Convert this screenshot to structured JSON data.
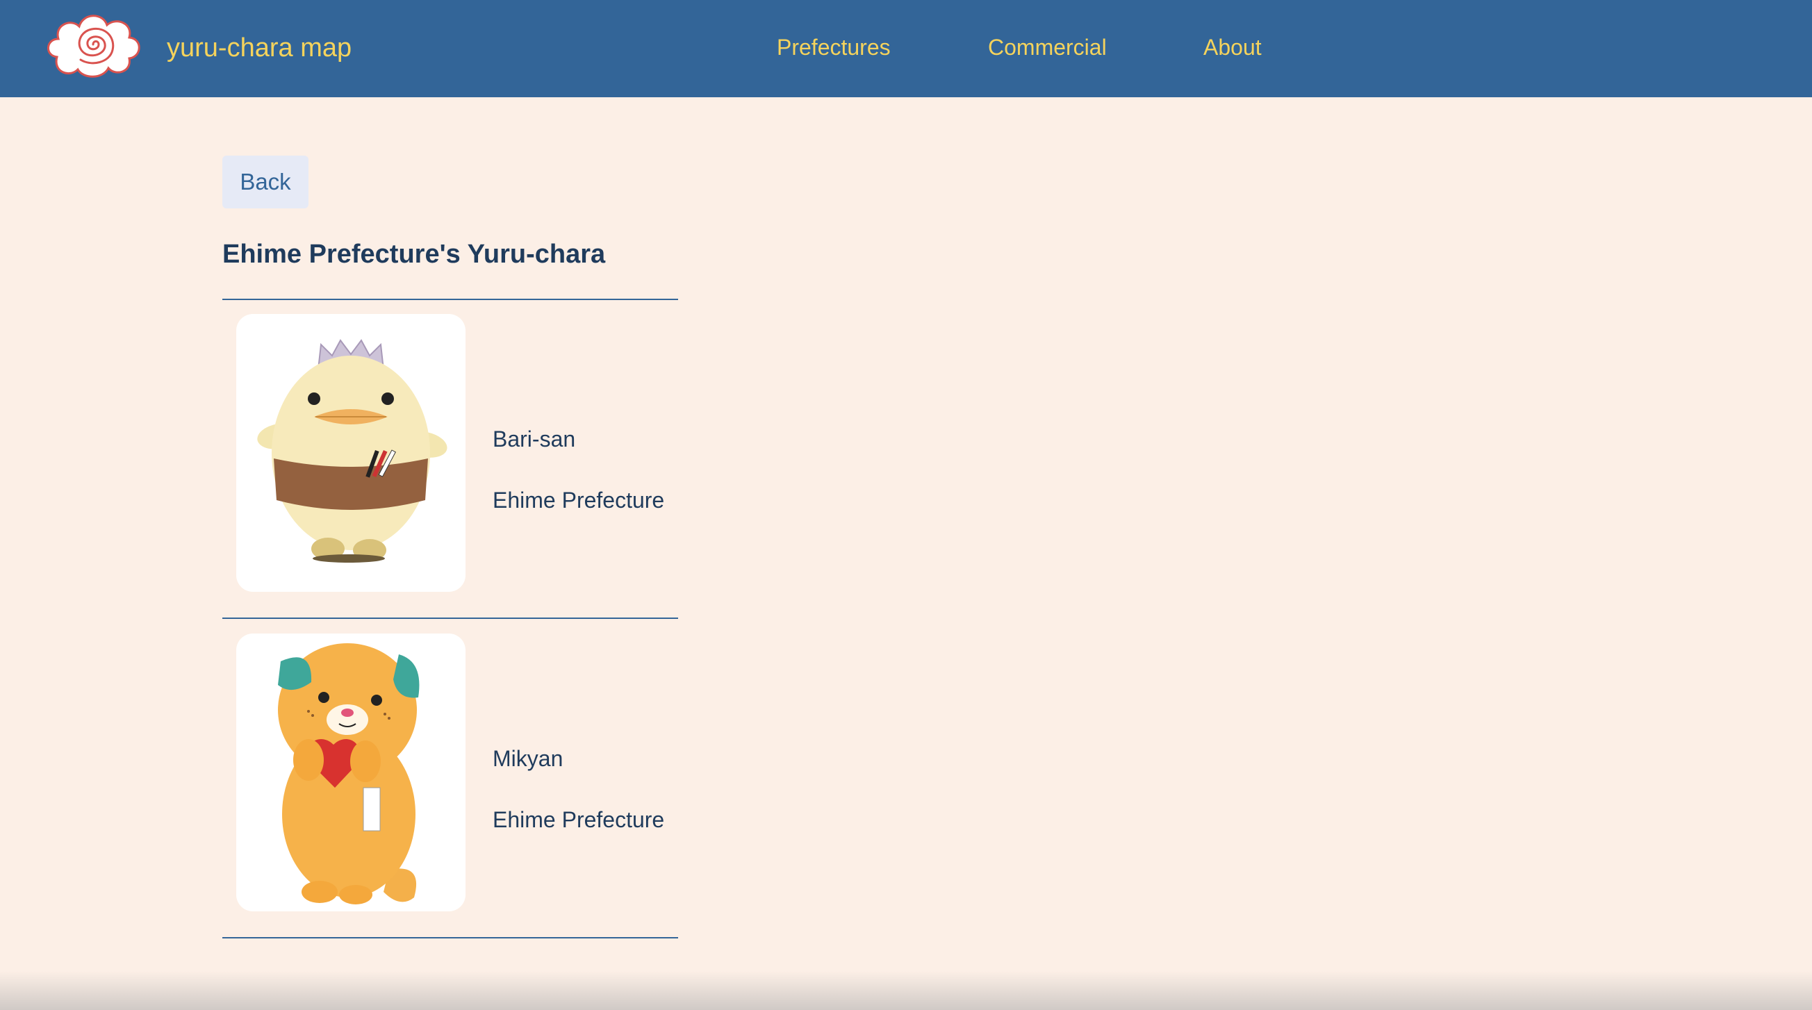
{
  "header": {
    "brand": "yuru-chara map",
    "logo_icon": "spiral-cloud-logo-icon",
    "nav": [
      {
        "label": "Prefectures"
      },
      {
        "label": "Commercial"
      },
      {
        "label": "About"
      }
    ]
  },
  "colors": {
    "navbar": "#336598",
    "nav_text": "#f5d35c",
    "page_background": "#fcefe6",
    "text": "#1f3b5c",
    "back_button_bg": "#e6eaf6"
  },
  "main": {
    "back_label": "Back",
    "title": "Ehime Prefecture's Yuru-chara",
    "characters": [
      {
        "name": "Bari-san",
        "prefecture": "Ehime Prefecture",
        "image_icon": "bari-san-mascot-image"
      },
      {
        "name": "Mikyan",
        "prefecture": "Ehime Prefecture",
        "image_icon": "mikyan-mascot-image"
      }
    ]
  }
}
